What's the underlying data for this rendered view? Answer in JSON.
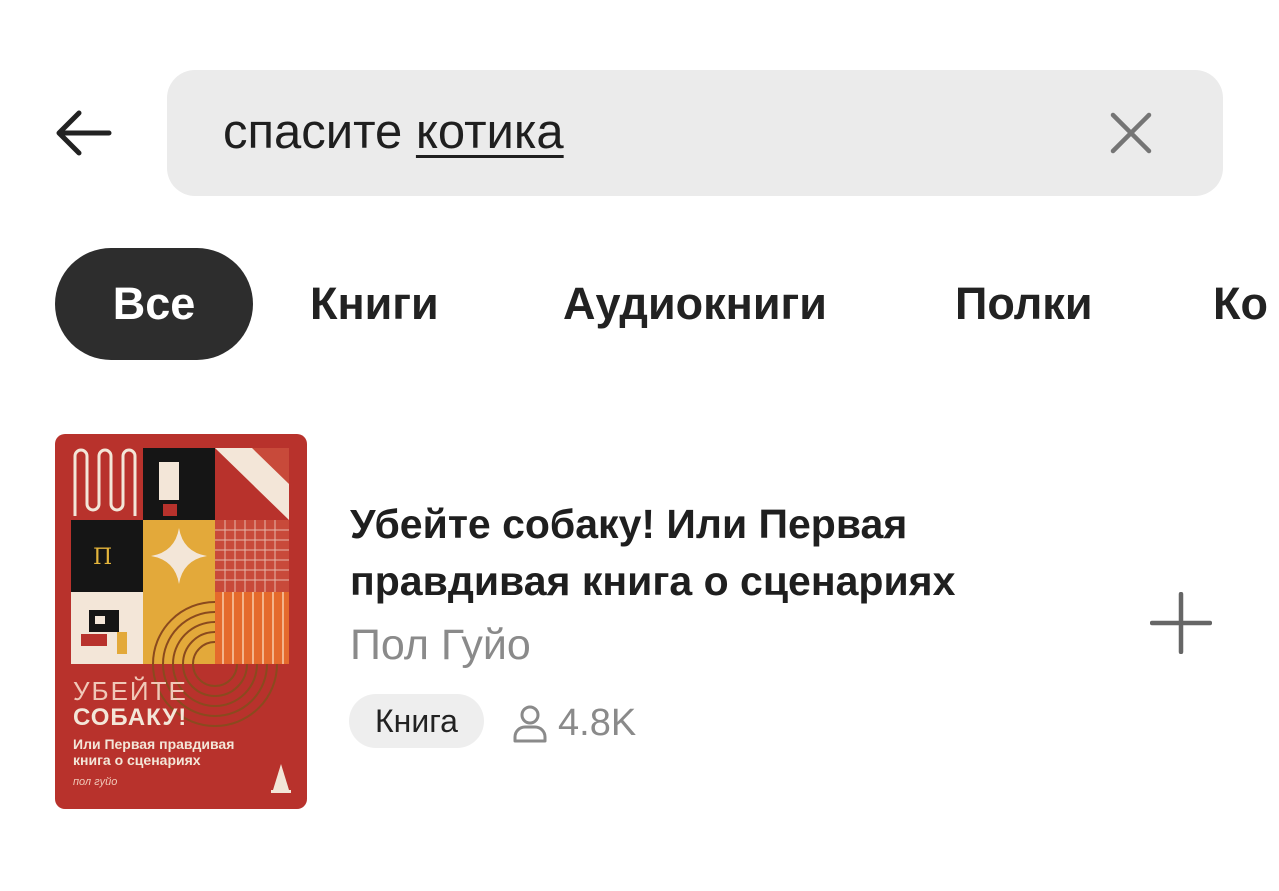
{
  "search": {
    "query_plain": "спасите ",
    "query_underlined": "котика"
  },
  "tabs": [
    {
      "label": "Все",
      "active": true
    },
    {
      "label": "Книги",
      "active": false
    },
    {
      "label": "Аудиокниги",
      "active": false
    },
    {
      "label": "Полки",
      "active": false
    },
    {
      "label": "Ко",
      "active": false
    }
  ],
  "results": [
    {
      "title": "Убейте собаку! Или Первая правдивая книга о сценариях",
      "author": "Пол Гуйо",
      "type_badge": "Книга",
      "readers_count": "4.8K",
      "cover": {
        "title_line1": "УБЕЙТЕ",
        "title_line2": "СОБАКУ!",
        "subtitle_line1": "Или Первая правдивая",
        "subtitle_line2": "книга о сценариях",
        "author": "пол гуйо"
      }
    }
  ],
  "icons": {
    "back": "arrow-left-icon",
    "clear": "close-icon",
    "readers": "person-icon",
    "add": "plus-icon"
  },
  "colors": {
    "search_bg": "#ebebeb",
    "active_tab_bg": "#2d2d2d",
    "cover_red": "#b8322c",
    "muted_text": "#8a8a8a"
  }
}
